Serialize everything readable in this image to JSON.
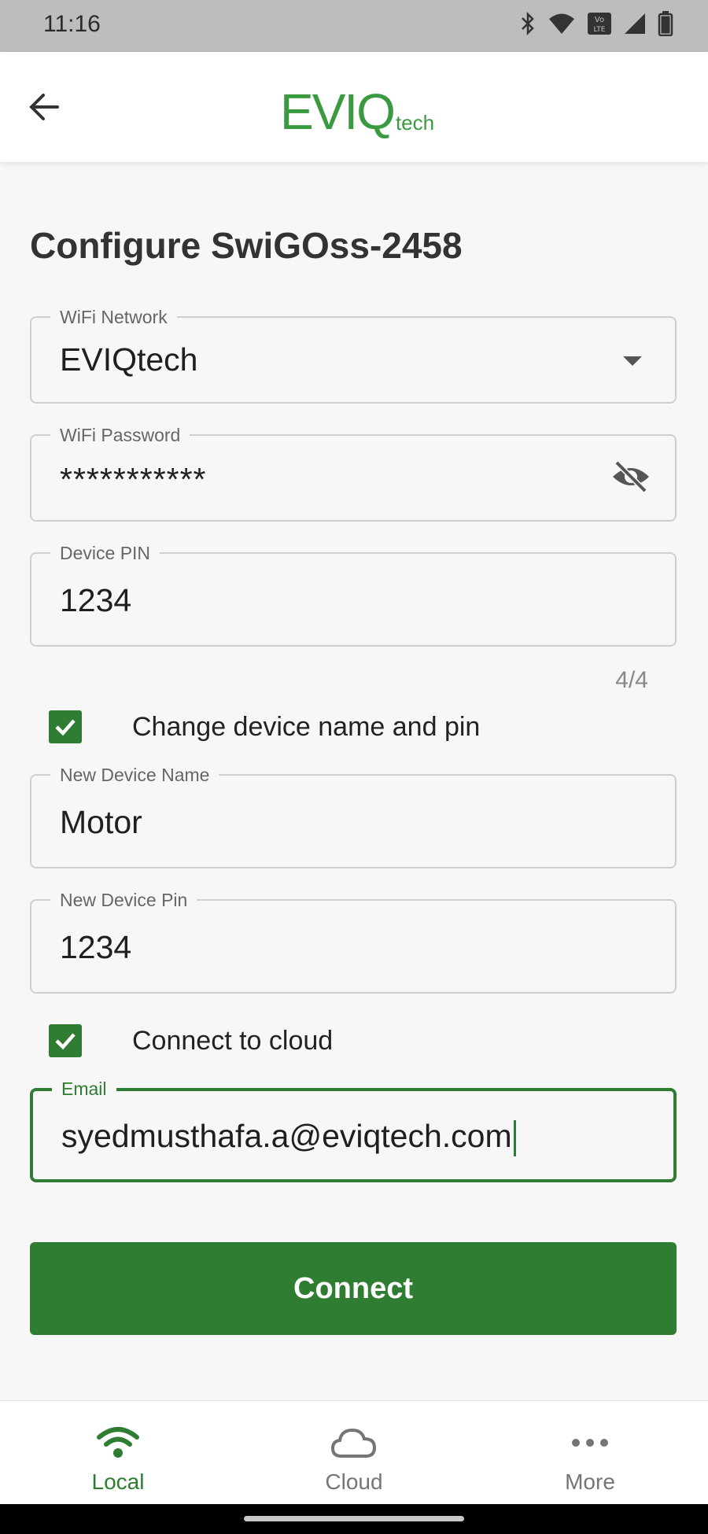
{
  "status_bar": {
    "time": "11:16",
    "icons": [
      "bluetooth-icon",
      "wifi-icon",
      "volte-icon",
      "signal-icon",
      "battery-icon"
    ]
  },
  "app_bar": {
    "back_icon": "arrow-left-icon",
    "logo_main": "EVIQ",
    "logo_sub": "tech"
  },
  "form": {
    "title": "Configure SwiGOss-2458",
    "wifi_network": {
      "label": "WiFi Network",
      "value": "EVIQtech"
    },
    "wifi_password": {
      "label": "WiFi Password",
      "value": "***********",
      "toggle_icon": "eye-off-icon"
    },
    "device_pin": {
      "label": "Device PIN",
      "value": "1234",
      "counter": "4/4"
    },
    "change_device": {
      "label": "Change device name and pin",
      "checked": true
    },
    "new_device_name": {
      "label": "New Device Name",
      "value": "Motor"
    },
    "new_device_pin": {
      "label": "New Device Pin",
      "value": "1234"
    },
    "connect_cloud": {
      "label": "Connect to cloud",
      "checked": true
    },
    "email": {
      "label": "Email",
      "value": "syedmusthafa.a@eviqtech.com"
    },
    "connect_button": "Connect"
  },
  "bottom_nav": {
    "items": [
      {
        "label": "Local",
        "icon": "wifi-icon",
        "active": true
      },
      {
        "label": "Cloud",
        "icon": "cloud-icon",
        "active": false
      },
      {
        "label": "More",
        "icon": "more-horizontal-icon",
        "active": false
      }
    ]
  },
  "colors": {
    "accent": "#2f7d32",
    "logo": "#3a9a40",
    "status_bar": "#bdbdbd"
  }
}
